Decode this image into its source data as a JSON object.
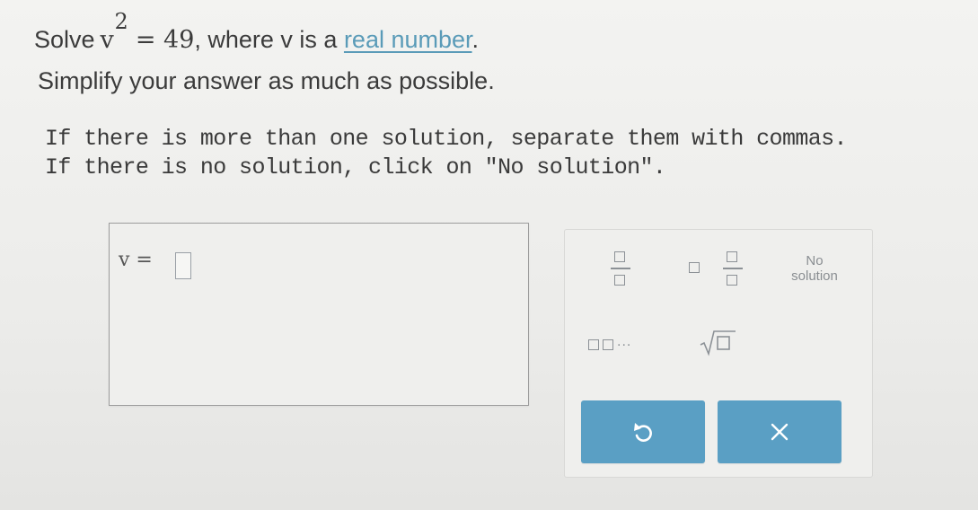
{
  "problem": {
    "solve_label": "Solve",
    "variable": "v",
    "exponent": "2",
    "equals_rhs": "= 49",
    "where_text": ", where v is a ",
    "link_text": "real number",
    "period": ".",
    "simplify_text": "Simplify your answer as much as possible.",
    "multi_solution_text": "If there is more than one solution, separate them with commas.",
    "no_solution_text": "If there is no solution, click on \"No solution\"."
  },
  "answer": {
    "label": "v =",
    "value": ""
  },
  "keypad": {
    "no_solution_line1": "No",
    "no_solution_line2": "solution",
    "ellipsis": "...",
    "undo_icon": "undo-icon",
    "clear_icon": "close-icon"
  },
  "colors": {
    "accent_blue": "#5a9fc4",
    "link_blue": "#5a9bb8",
    "text": "#3b3b3b",
    "icon_gray": "#8c9196"
  }
}
